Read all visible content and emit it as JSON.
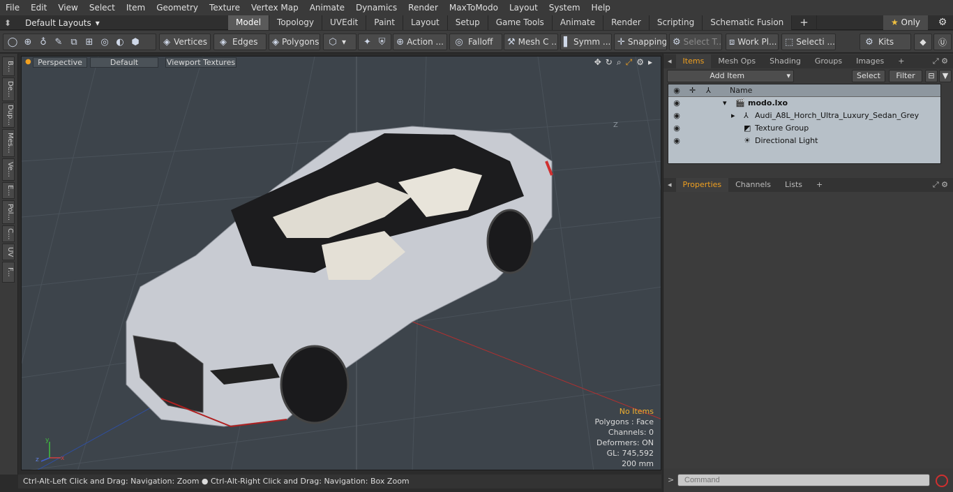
{
  "menubar": {
    "items": [
      "File",
      "Edit",
      "View",
      "Select",
      "Item",
      "Geometry",
      "Texture",
      "Vertex Map",
      "Animate",
      "Dynamics",
      "Render",
      "MaxToModo",
      "Layout",
      "System",
      "Help"
    ]
  },
  "layouts": {
    "label": "Default Layouts"
  },
  "tabs": [
    "Model",
    "Topology",
    "UVEdit",
    "Paint",
    "Layout",
    "Setup",
    "Game Tools",
    "Animate",
    "Render",
    "Scripting",
    "Schematic Fusion"
  ],
  "active_tab": "Model",
  "only_label": "Only",
  "toolbar": {
    "vertices": "Vertices",
    "edges": "Edges",
    "polygons": "Polygons",
    "action": "Action ...",
    "falloff": "Falloff",
    "mesh": "Mesh C ...",
    "symm": "Symm ...",
    "snapping": "Snapping",
    "select_t": "Select T...",
    "work_pl": "Work Pl...",
    "selecti": "Selecti ...",
    "kits": "Kits"
  },
  "left_tabs": [
    "B...",
    "De...",
    "Dup...",
    "Mes...",
    "Ve...",
    "E...",
    "Pol...",
    "C...",
    "UV",
    "F..."
  ],
  "viewport": {
    "perspective": "Perspective",
    "shading": "Default",
    "textures": "Viewport Textures",
    "info": {
      "no_items": "No Items",
      "polygons": "Polygons : Face",
      "channels": "Channels: 0",
      "deformers": "Deformers: ON",
      "gl": "GL: 745,592",
      "unit": "200 mm"
    },
    "axis_z_label": "Z"
  },
  "status": "Ctrl-Alt-Left Click and Drag: Navigation: Zoom ● Ctrl-Alt-Right Click and Drag: Navigation: Box Zoom",
  "items_panel": {
    "tabs": [
      "Items",
      "Mesh Ops",
      "Shading",
      "Groups",
      "Images"
    ],
    "add_item": "Add Item",
    "select": "Select",
    "filter": "Filter",
    "col_name": "Name",
    "rows": [
      "modo.lxo",
      "Audi_A8L_Horch_Ultra_Luxury_Sedan_Grey",
      "Texture Group",
      "Directional Light"
    ]
  },
  "props_panel": {
    "tabs": [
      "Properties",
      "Channels",
      "Lists"
    ]
  },
  "command": {
    "placeholder": "Command"
  },
  "colors": {
    "accent": "#f0a020",
    "viewport_bg": "#3d444b",
    "car_body": "#c8cbd2"
  }
}
